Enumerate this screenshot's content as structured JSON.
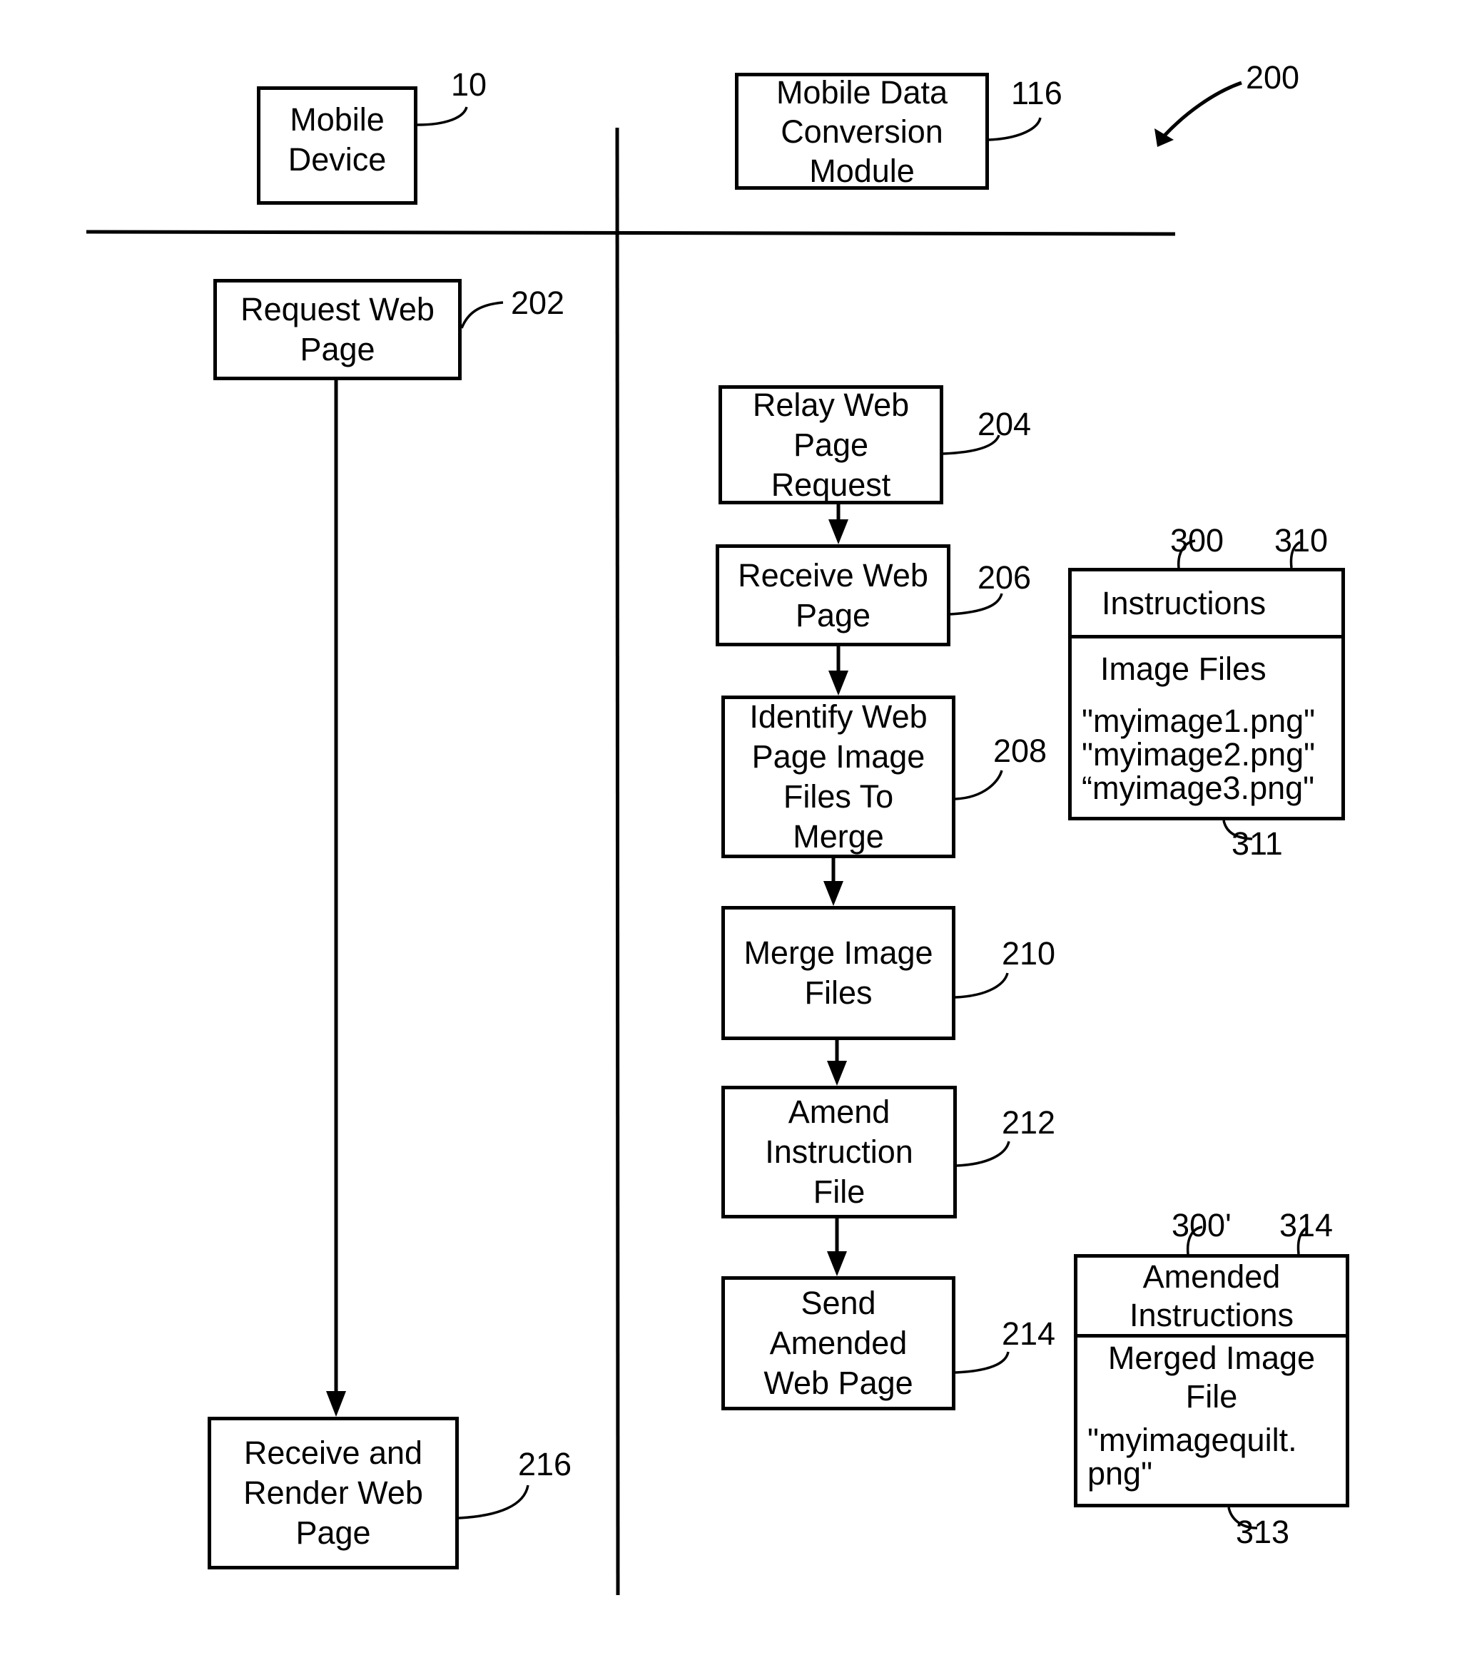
{
  "figure": {
    "ref": "200",
    "lanes": {
      "mobile_device": {
        "title": "Mobile Device",
        "ref": "10"
      },
      "conversion_module": {
        "title": "Mobile Data Conversion Module",
        "ref": "116"
      }
    }
  },
  "steps": [
    {
      "id": "request",
      "label": "Request Web\nPage",
      "ref": "202"
    },
    {
      "id": "relay",
      "label": "Relay Web\nPage\nRequest",
      "ref": "204"
    },
    {
      "id": "receive",
      "label": "Receive Web\nPage",
      "ref": "206"
    },
    {
      "id": "identify",
      "label": "Identify Web\nPage Image\nFiles To\nMerge",
      "ref": "208"
    },
    {
      "id": "merge",
      "label": "Merge Image\nFiles",
      "ref": "210"
    },
    {
      "id": "amend",
      "label": "Amend\nInstruction\nFile",
      "ref": "212"
    },
    {
      "id": "send",
      "label": "Send\nAmended\nWeb Page",
      "ref": "214"
    },
    {
      "id": "render",
      "label": "Receive and\nRender Web\nPage",
      "ref": "216"
    }
  ],
  "web_page": {
    "ref": "300",
    "instructions": {
      "label": "Instructions",
      "ref": "310"
    },
    "images": {
      "label": "Image Files",
      "ref": "311",
      "files": [
        "\"myimage1.png\"",
        "\"myimage2.png\"",
        "“myimage3.png\""
      ]
    }
  },
  "amended_web_page": {
    "ref": "300'",
    "instructions": {
      "label": "Amended\nInstructions",
      "ref": "314"
    },
    "images": {
      "label": "Merged Image\nFile",
      "ref": "313",
      "file": "\"myimagequilt.\npng\""
    }
  }
}
